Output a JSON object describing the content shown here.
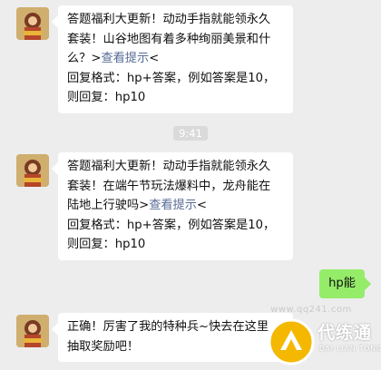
{
  "messages": [
    {
      "lines": [
        "答题福利大更新！动动手指就能领永久",
        "套装！山谷地图有着多种绚丽美景和什",
        "么？>"
      ],
      "link": "查看提示",
      "link_suffix": "<",
      "reply_lines": [
        "回复格式：hp+答案，例如答案是10，",
        "则回复：hp10"
      ]
    },
    {
      "lines": [
        "答题福利大更新！动动手指就能领永久",
        "套装！在端午节玩法爆料中，龙舟能在",
        "陆地上行驶吗>"
      ],
      "link": "查看提示",
      "link_suffix": "<",
      "reply_lines": [
        "回复格式：hp+答案，例如答案是10，",
        "则回复：hp10"
      ]
    },
    {
      "lines": [
        "正确！厉害了我的特种兵~快去在这里",
        "抽取奖励吧！"
      ]
    }
  ],
  "timestamp": "9:41",
  "my_reply": "hp能",
  "watermark": {
    "url": "www.qq241.com",
    "title": "代练通",
    "subtitle": "DAI LIAN TONG"
  },
  "colors": {
    "background": "#ededed",
    "incoming_bubble": "#ffffff",
    "outgoing_bubble": "#95ec69",
    "link": "#576b95",
    "watermark_accent": "#f5b800"
  }
}
